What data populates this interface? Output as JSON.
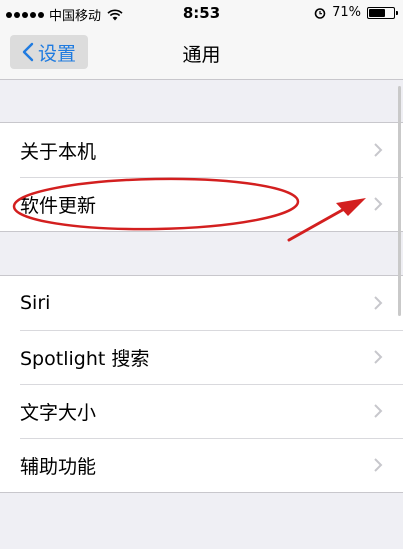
{
  "status_bar": {
    "carrier": "中国移动",
    "time": "8:53",
    "battery": "71%",
    "battery_level": 0.71,
    "icons": [
      "signal-dots-icon",
      "wifi-icon",
      "alarm-icon",
      "battery-icon"
    ]
  },
  "nav": {
    "back_label": "设置",
    "title": "通用"
  },
  "sections": [
    {
      "items": [
        {
          "label": "关于本机"
        },
        {
          "label": "软件更新"
        }
      ]
    },
    {
      "items": [
        {
          "label": "Siri"
        },
        {
          "label": "Spotlight 搜索"
        },
        {
          "label": "文字大小"
        },
        {
          "label": "辅助功能"
        }
      ]
    }
  ],
  "colors": {
    "accent": "#1f7be0",
    "annotation": "#d31f1f",
    "background": "#efeff4"
  }
}
